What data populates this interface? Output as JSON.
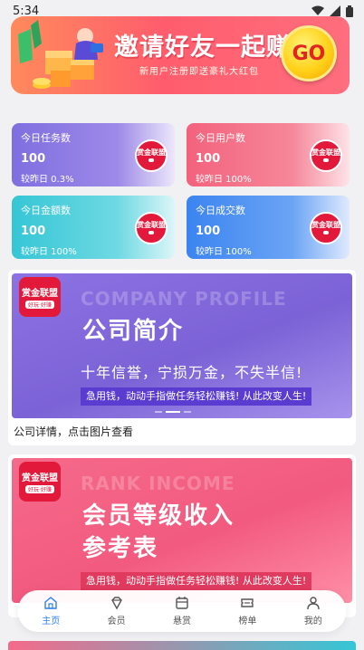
{
  "status": {
    "time": "5:34"
  },
  "banner": {
    "title": "邀请好友一起赚钱",
    "subtitle": "新用户注册即送豪礼大红包",
    "go_label": "GO"
  },
  "stats": [
    {
      "label": "今日任务数",
      "value": "100",
      "compare": "较昨日 0.3%",
      "logo": "赏金联盟"
    },
    {
      "label": "今日用户数",
      "value": "100",
      "compare": "较昨日 100%",
      "logo": "赏金联盟"
    },
    {
      "label": "今日金额数",
      "value": "100",
      "compare": "较昨日 100%",
      "logo": "赏金联盟"
    },
    {
      "label": "今日成交数",
      "value": "100",
      "compare": "较昨日 100%",
      "logo": "赏金联盟"
    }
  ],
  "company": {
    "logo": "赏金联盟",
    "logo_sub": "好玩·好赚",
    "bg_text": "COMPANY PROFILE",
    "title": "公司简介",
    "motto": "十年信誉，宁损万金，不失半信!",
    "strip": "急用钱，动动手指做任务轻松赚钱! 从此改变人生!",
    "caption": "公司详情，点击图片查看"
  },
  "rank": {
    "logo": "赏金联盟",
    "logo_sub": "好玩·好赚",
    "bg_text": "RANK INCOME",
    "title_line1": "会员等级收入",
    "title_line2": "参考表",
    "strip": "急用钱，动动手指做任务轻松赚钱! 从此改变人生!"
  },
  "tabs": [
    {
      "label": "主页",
      "icon": "home-icon",
      "active": true
    },
    {
      "label": "会员",
      "icon": "diamond-icon",
      "active": false
    },
    {
      "label": "悬赏",
      "icon": "calendar-icon",
      "active": false
    },
    {
      "label": "榜单",
      "icon": "ticket-icon",
      "active": false
    },
    {
      "label": "我的",
      "icon": "user-icon",
      "active": false
    }
  ],
  "colors": {
    "accent": "#2f7ef5",
    "banner": "#ff5d6d",
    "go": "#ffd21a"
  }
}
